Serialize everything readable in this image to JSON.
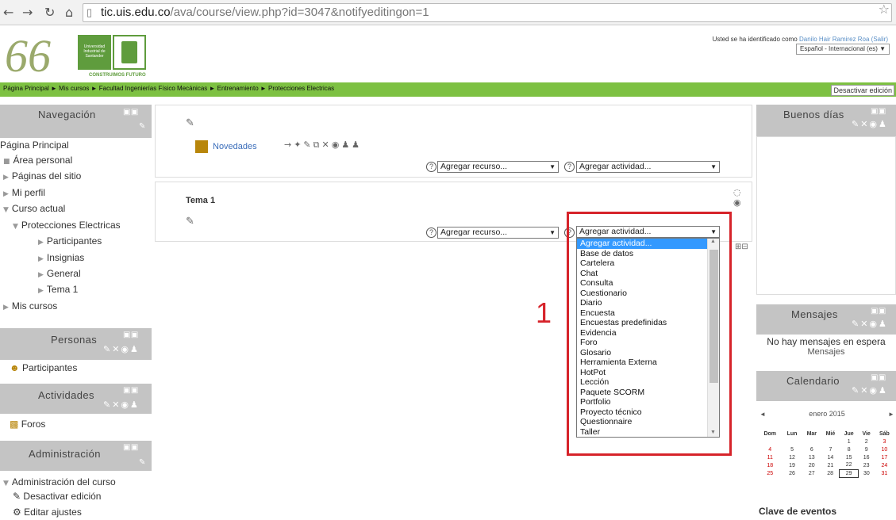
{
  "browser": {
    "url_host": "tic.uis.edu.co",
    "url_path": "/ava/course/view.php?id=3047&notifyeditingon=1"
  },
  "header": {
    "logo_text": "66",
    "univ_text": "Universidad Industrial de Santander",
    "tagline": "CONSTRUIMOS FUTURO",
    "login_prefix": "Usted se ha identificado como ",
    "login_user": "Danilo Hair Ramirez Roa (Salir)",
    "language": "Español - Internacional (es)"
  },
  "breadcrumb": "Página Principal ► Mis cursos ► Facultad Ingenierías Físico Mecánicas ► Entrenamiento ► Protecciones Electricas",
  "edit_button": "Desactivar edición",
  "navigation": {
    "title": "Navegación",
    "items": [
      "Página Principal",
      "Área personal",
      "Páginas del sitio",
      "Mi perfil",
      "Curso actual",
      "Protecciones Electricas",
      "Participantes",
      "Insignias",
      "General",
      "Tema 1",
      "Mis cursos"
    ]
  },
  "personas": {
    "title": "Personas",
    "item": "Participantes"
  },
  "actividades": {
    "title": "Actividades",
    "item": "Foros"
  },
  "administracion": {
    "title": "Administración",
    "items": [
      "Administración del curso",
      "Desactivar edición",
      "Editar ajustes"
    ]
  },
  "section0": {
    "news": "Novedades",
    "add_resource": "Agregar recurso...",
    "add_activity": "Agregar actividad..."
  },
  "section1": {
    "title": "Tema 1",
    "add_resource": "Agregar recurso...",
    "add_activity": "Agregar actividad..."
  },
  "dropdown_options": [
    "Agregar actividad...",
    "Base de datos",
    "Cartelera",
    "Chat",
    "Consulta",
    "Cuestionario",
    "Diario",
    "Encuesta",
    "Encuestas predefinidas",
    "Evidencia",
    "Foro",
    "Glosario",
    "Herramienta Externa",
    "HotPot",
    "Lección",
    "Paquete SCORM",
    "Portfolio",
    "Proyecto técnico",
    "Questionnaire",
    "Taller"
  ],
  "annotation_number": "1",
  "right_blocks": {
    "greeting": "Buenos días",
    "messages_title": "Mensajes",
    "messages_text": "No hay mensajes en espera",
    "messages_link": "Mensajes",
    "calendar_title": "Calendario",
    "calendar_month": "enero 2015",
    "calendar_days": [
      "Dom",
      "Lun",
      "Mar",
      "Mié",
      "Jue",
      "Vie",
      "Sáb"
    ],
    "calendar_weeks": [
      [
        "",
        "",
        "",
        "",
        "1",
        "2",
        "3"
      ],
      [
        "4",
        "5",
        "6",
        "7",
        "8",
        "9",
        "10"
      ],
      [
        "11",
        "12",
        "13",
        "14",
        "15",
        "16",
        "17"
      ],
      [
        "18",
        "19",
        "20",
        "21",
        "22",
        "23",
        "24"
      ],
      [
        "25",
        "26",
        "27",
        "28",
        "29",
        "30",
        "31"
      ]
    ],
    "events_key": "Clave de eventos"
  },
  "colors": {
    "green": "#7dc142",
    "red": "#d6232a",
    "block": "#c4c4c4",
    "select_blue": "#3399ff"
  }
}
